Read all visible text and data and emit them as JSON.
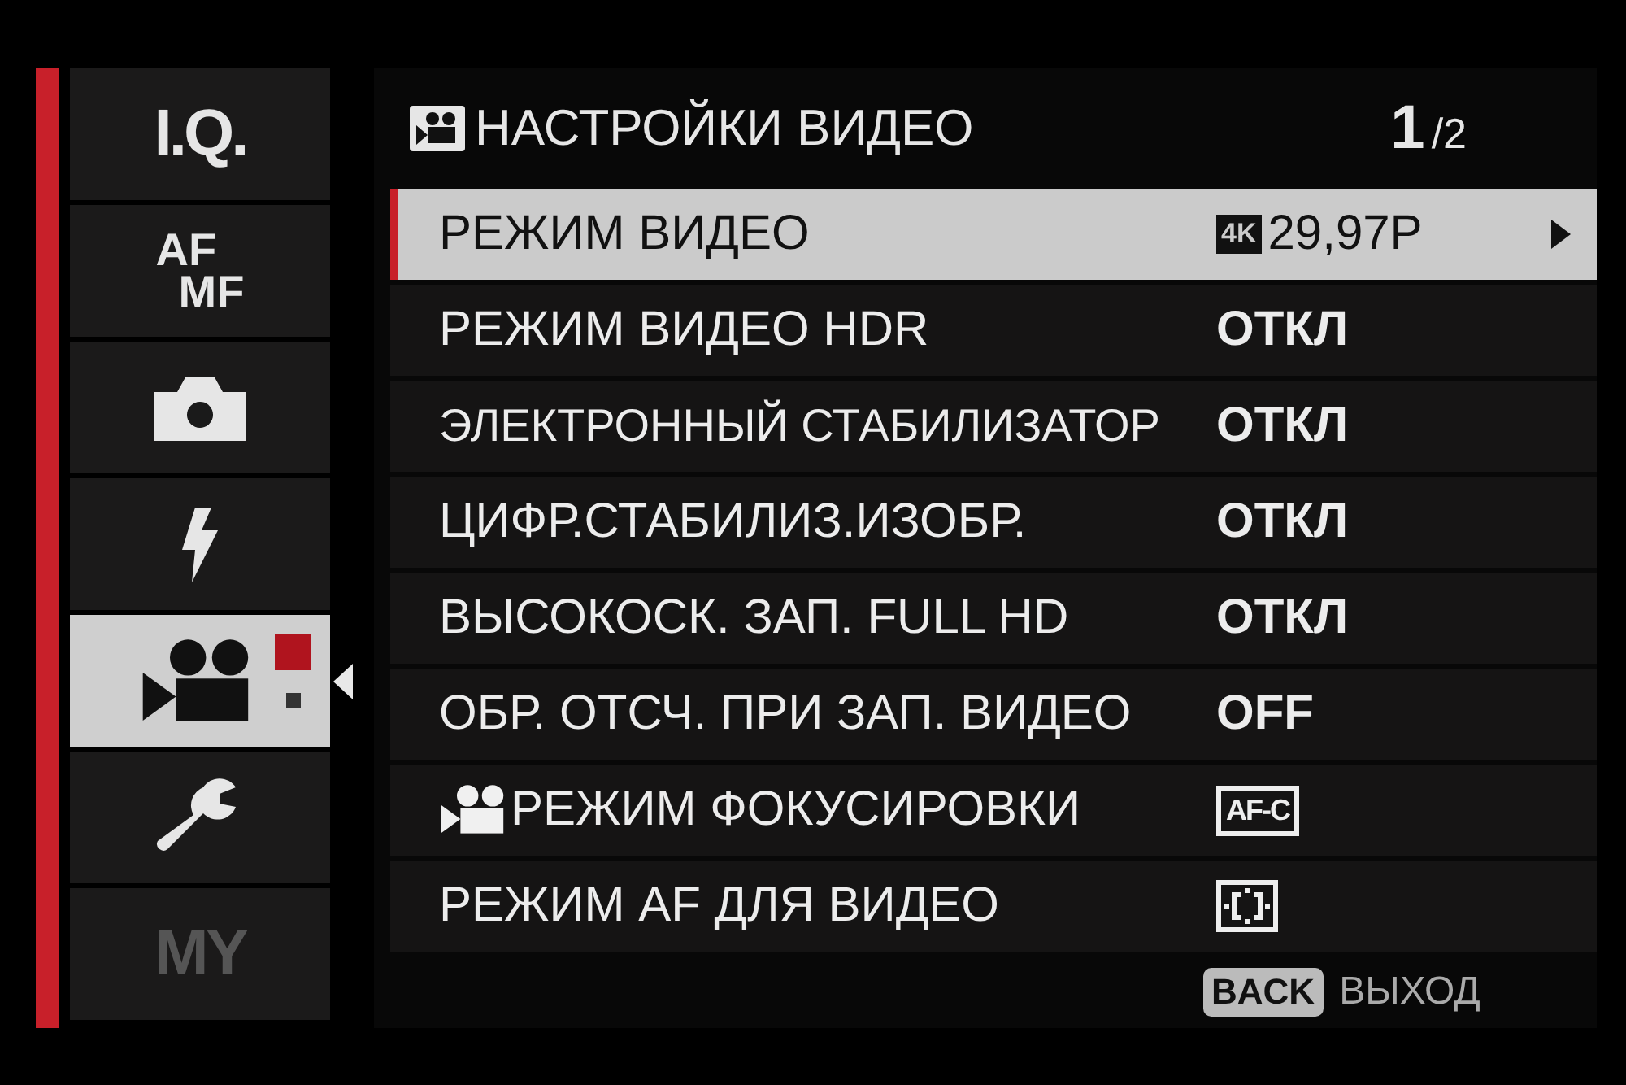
{
  "sidebar": {
    "tabs": [
      {
        "kind": "text",
        "label": "I.Q.",
        "selected": false,
        "disabled": false
      },
      {
        "kind": "stacked",
        "lines": [
          "AF",
          "MF"
        ],
        "selected": false,
        "disabled": false
      },
      {
        "kind": "camera",
        "selected": false,
        "disabled": false
      },
      {
        "kind": "flash",
        "selected": false,
        "disabled": false
      },
      {
        "kind": "movie",
        "selected": true,
        "disabled": false,
        "pages": [
          {
            "selected": true
          },
          {
            "selected": false
          }
        ]
      },
      {
        "kind": "wrench",
        "selected": false,
        "disabled": false
      },
      {
        "kind": "text",
        "label": "MY",
        "selected": false,
        "disabled": true
      }
    ]
  },
  "header": {
    "title": "НАСТРОЙКИ ВИДЕО",
    "page": "1",
    "page_total": "/2"
  },
  "rows": [
    {
      "label": "РЕЖИМ ВИДЕО",
      "movie_icon": false,
      "selected": true,
      "submenu": true,
      "value": {
        "kind": "badge_text",
        "badge": "4K",
        "text": "29,97P"
      }
    },
    {
      "label": "РЕЖИМ ВИДЕО HDR",
      "movie_icon": false,
      "selected": false,
      "submenu": false,
      "value": {
        "kind": "text",
        "text": "ОТКЛ"
      }
    },
    {
      "label": "ЭЛЕКТРОННЫЙ СТАБИЛИЗАТОР",
      "movie_icon": false,
      "selected": false,
      "submenu": false,
      "value": {
        "kind": "text",
        "text": "ОТКЛ"
      }
    },
    {
      "label": "ЦИФР.СТАБИЛИЗ.ИЗОБР.",
      "movie_icon": false,
      "selected": false,
      "submenu": false,
      "value": {
        "kind": "text",
        "text": "ОТКЛ"
      }
    },
    {
      "label": "ВЫСОКОСК. ЗАП. FULL HD",
      "movie_icon": false,
      "selected": false,
      "submenu": false,
      "value": {
        "kind": "text",
        "text": "ОТКЛ"
      }
    },
    {
      "label": "ОБР. ОТСЧ. ПРИ ЗАП. ВИДЕО",
      "movie_icon": false,
      "selected": false,
      "submenu": false,
      "value": {
        "kind": "text",
        "text": "OFF"
      }
    },
    {
      "label": "РЕЖИМ ФОКУСИРОВКИ",
      "movie_icon": true,
      "selected": false,
      "submenu": false,
      "value": {
        "kind": "boxed",
        "text": "AF-C"
      }
    },
    {
      "label": "РЕЖИМ AF ДЛЯ ВИДЕО",
      "movie_icon": false,
      "selected": false,
      "submenu": false,
      "value": {
        "kind": "af_area"
      }
    }
  ],
  "footer": {
    "key": "BACK",
    "label": "ВЫХОД"
  }
}
